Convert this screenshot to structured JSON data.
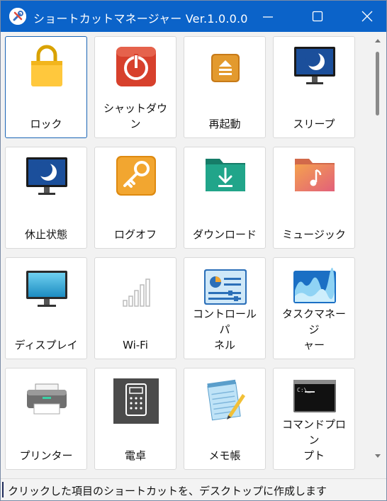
{
  "window": {
    "title": "ショートカットマネージャー Ver.1.0.0.0",
    "app_icon": "tools-icon"
  },
  "tiles": [
    {
      "label": "ロック",
      "icon": "lock-icon",
      "selected": true
    },
    {
      "label": "シャットダウン",
      "icon": "power-icon"
    },
    {
      "label": "再起動",
      "icon": "restart-icon"
    },
    {
      "label": "スリープ",
      "icon": "sleep-monitor-icon"
    },
    {
      "label": "休止状態",
      "icon": "hibernate-monitor-icon"
    },
    {
      "label": "ログオフ",
      "icon": "key-icon"
    },
    {
      "label": "ダウンロード",
      "icon": "downloads-folder-icon"
    },
    {
      "label": "ミュージック",
      "icon": "music-folder-icon"
    },
    {
      "label": "ディスプレイ",
      "icon": "display-icon"
    },
    {
      "label": "Wi-Fi",
      "icon": "wifi-signal-icon"
    },
    {
      "label": "コントロールパ\nネル",
      "icon": "control-panel-icon"
    },
    {
      "label": "タスクマネージ\nャー",
      "icon": "task-manager-icon"
    },
    {
      "label": "プリンター",
      "icon": "printer-icon"
    },
    {
      "label": "電卓",
      "icon": "calculator-icon"
    },
    {
      "label": "メモ帳",
      "icon": "notepad-icon"
    },
    {
      "label": "コマンドプロン\nプト",
      "icon": "command-prompt-icon"
    }
  ],
  "status": {
    "text": "クリックした項目のショートカットを、デスクトップに作成します"
  },
  "colors": {
    "titlebar": "#0b63c9",
    "selected_border": "#1a64b4"
  }
}
